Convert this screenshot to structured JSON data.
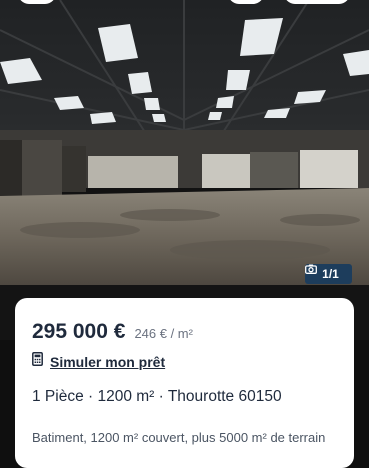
{
  "photo": {
    "counter": "1/1",
    "counter_icon": "camera-icon"
  },
  "listing": {
    "price": "295 000 €",
    "price_per_m2": "246 € / m²",
    "loan_icon": "calculator-icon",
    "loan_label": "Simuler mon prêt",
    "summary": "1 Pièce · 1200 m² · Thourotte 60150",
    "description": "Batiment, 1200 m² couvert, plus 5000 m² de terrain"
  },
  "colors": {
    "accent": "#1d3d5c",
    "text": "#1f2a3c"
  }
}
